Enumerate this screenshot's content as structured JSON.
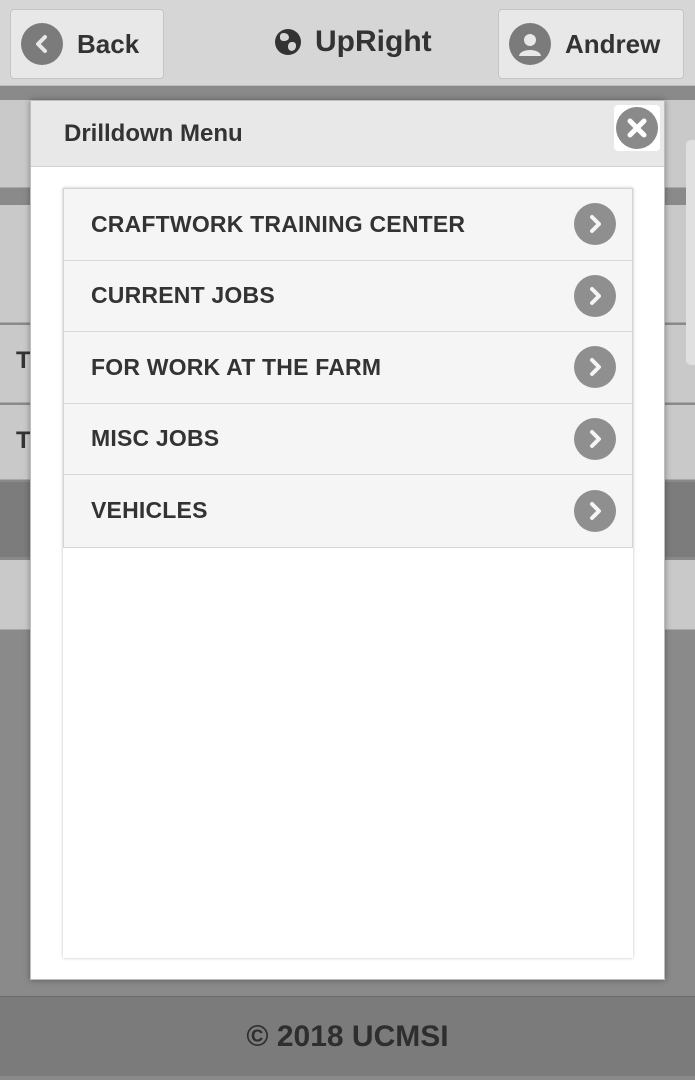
{
  "header": {
    "back_label": "Back",
    "app_title": "UpRight",
    "user_name": "Andrew"
  },
  "background": {
    "row_letters": [
      "T",
      "T"
    ]
  },
  "modal": {
    "title": "Drilldown Menu",
    "close_icon": "close-icon",
    "items": [
      {
        "label": "CRAFTWORK TRAINING CENTER",
        "icon": "chevron-right-icon"
      },
      {
        "label": "CURRENT JOBS",
        "icon": "chevron-right-icon"
      },
      {
        "label": "FOR WORK AT THE FARM",
        "icon": "chevron-right-icon"
      },
      {
        "label": "MISC JOBS",
        "icon": "chevron-right-icon"
      },
      {
        "label": "VEHICLES",
        "icon": "chevron-right-icon"
      }
    ]
  },
  "footer": {
    "copyright": "© 2018 UCMSI"
  }
}
